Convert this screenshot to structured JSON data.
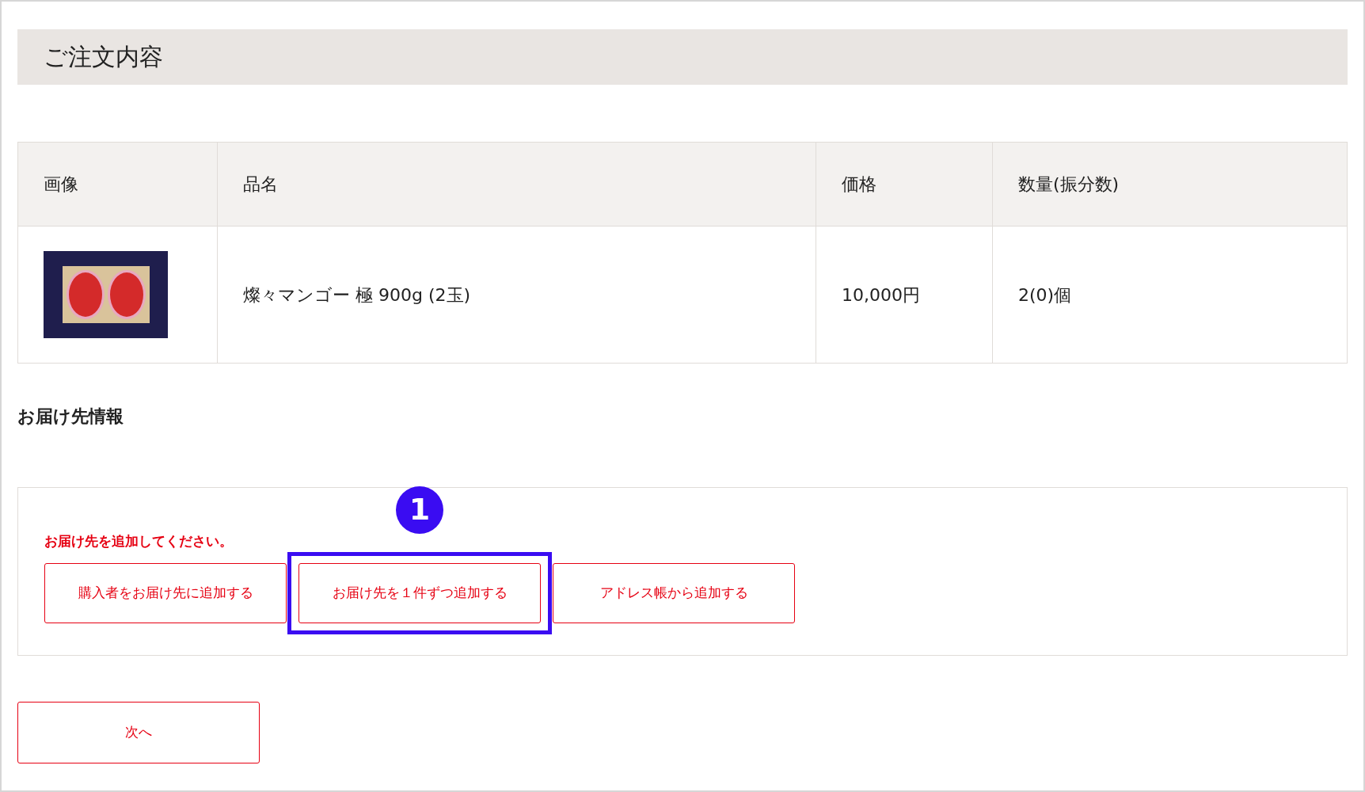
{
  "heading": "ご注文内容",
  "table": {
    "columns": [
      "画像",
      "品名",
      "価格",
      "数量(振分数)"
    ],
    "rows": [
      {
        "product_name": "燦々マンゴー 極 900g (2玉)",
        "price": "10,000円",
        "quantity": "2(0)個"
      }
    ]
  },
  "delivery_section": {
    "title": "お届け先情報",
    "notice": "お届け先を追加してください。",
    "buttons": [
      {
        "label": "購入者をお届け先に追加する",
        "highlighted": false
      },
      {
        "label": "お届け先を１件ずつ追加する",
        "highlighted": true,
        "annotation": "1"
      },
      {
        "label": "アドレス帳から追加する",
        "highlighted": false
      }
    ]
  },
  "next_button": "次へ"
}
